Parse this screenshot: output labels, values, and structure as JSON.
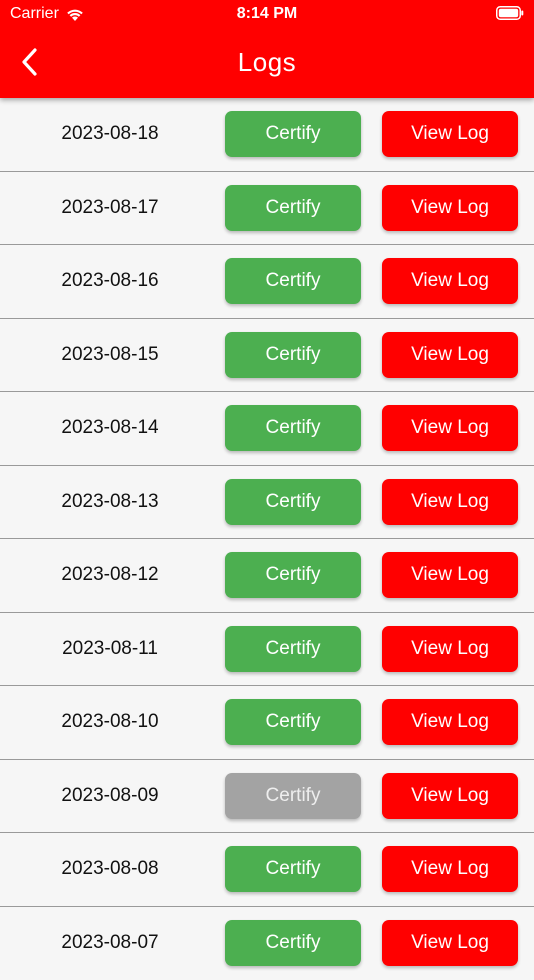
{
  "status_bar": {
    "carrier": "Carrier",
    "time": "8:14 PM"
  },
  "header": {
    "title": "Logs"
  },
  "colors": {
    "header": "#ff0000",
    "certify": "#4caf50",
    "certify_disabled": "#a3a3a3",
    "view_log": "#ff0000"
  },
  "icons": {
    "back": "chevron-left-icon",
    "wifi": "wifi-icon",
    "battery": "battery-icon"
  },
  "logs": [
    {
      "date": "2023-08-18",
      "certify_label": "Certify",
      "view_label": "View Log",
      "certify_enabled": true
    },
    {
      "date": "2023-08-17",
      "certify_label": "Certify",
      "view_label": "View Log",
      "certify_enabled": true
    },
    {
      "date": "2023-08-16",
      "certify_label": "Certify",
      "view_label": "View Log",
      "certify_enabled": true
    },
    {
      "date": "2023-08-15",
      "certify_label": "Certify",
      "view_label": "View Log",
      "certify_enabled": true
    },
    {
      "date": "2023-08-14",
      "certify_label": "Certify",
      "view_label": "View Log",
      "certify_enabled": true
    },
    {
      "date": "2023-08-13",
      "certify_label": "Certify",
      "view_label": "View Log",
      "certify_enabled": true
    },
    {
      "date": "2023-08-12",
      "certify_label": "Certify",
      "view_label": "View Log",
      "certify_enabled": true
    },
    {
      "date": "2023-08-11",
      "certify_label": "Certify",
      "view_label": "View Log",
      "certify_enabled": true
    },
    {
      "date": "2023-08-10",
      "certify_label": "Certify",
      "view_label": "View Log",
      "certify_enabled": true
    },
    {
      "date": "2023-08-09",
      "certify_label": "Certify",
      "view_label": "View Log",
      "certify_enabled": false
    },
    {
      "date": "2023-08-08",
      "certify_label": "Certify",
      "view_label": "View Log",
      "certify_enabled": true
    },
    {
      "date": "2023-08-07",
      "certify_label": "Certify",
      "view_label": "View Log",
      "certify_enabled": true
    }
  ]
}
